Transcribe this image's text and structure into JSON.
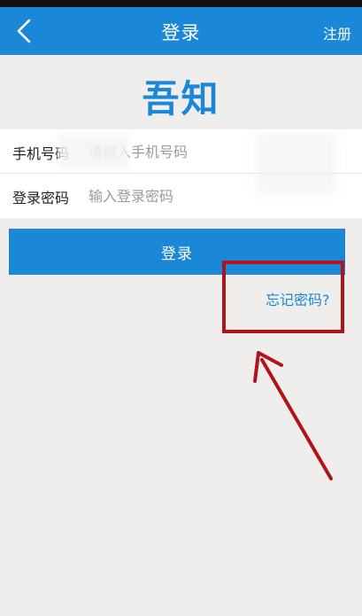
{
  "navbar": {
    "title": "登录",
    "register_label": "注册"
  },
  "logo": {
    "text": "吾知"
  },
  "form": {
    "phone": {
      "label": "手机号码",
      "placeholder": "请输入手机号码"
    },
    "password": {
      "label": "登录密码",
      "placeholder": "输入登录密码"
    }
  },
  "login_button": {
    "label": "登录"
  },
  "forgot_password": {
    "label": "忘记密码?"
  },
  "colors": {
    "primary": "#1a87d7",
    "background": "#efeeec",
    "annotation": "#b0141a"
  }
}
